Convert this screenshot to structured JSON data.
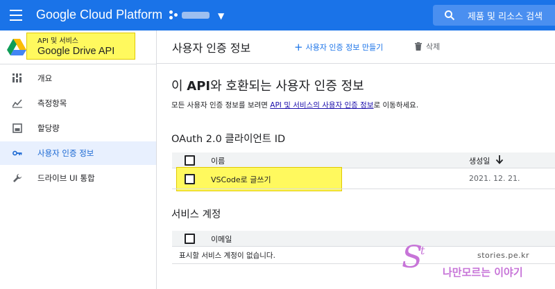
{
  "topbar": {
    "menu_icon": "hamburger-menu-icon",
    "brand": "Google Cloud Platform",
    "project_icon": "project-dots-icon",
    "project_name_redacted": true,
    "dropdown_icon": "caret-down-icon",
    "search_icon": "search-icon",
    "search_placeholder": "제품 및 리소스 검색",
    "bar_color": "#1a73e8"
  },
  "sidebar": {
    "api_kicker": "API 및 서비스",
    "api_name": "Google Drive API",
    "api_logo": "google-drive-logo",
    "items": [
      {
        "label": "개요",
        "icon": "dashboard-icon",
        "active": false
      },
      {
        "label": "측정항목",
        "icon": "metrics-icon",
        "active": false
      },
      {
        "label": "할당량",
        "icon": "quota-icon",
        "active": false
      },
      {
        "label": "사용자 인증 정보",
        "icon": "key-icon",
        "active": true
      },
      {
        "label": "드라이브 UI 통합",
        "icon": "wrench-icon",
        "active": false
      }
    ]
  },
  "header": {
    "title": "사용자 인증 정보",
    "create_label": "사용자 인증 정보 만들기",
    "create_icon": "plus-icon",
    "delete_label": "삭제",
    "delete_icon": "trash-icon"
  },
  "content": {
    "heading_pre": "이 ",
    "heading_bold": "API",
    "heading_post": "와 호환되는 사용자 인증 정보",
    "desc_pre": "모든 사용자 인증 정보를 보려면 ",
    "desc_link": "API 및 서비스의 사용자 인증 정보",
    "desc_post": "로 이동하세요."
  },
  "oauth": {
    "title": "OAuth 2.0 클라이언트 ID",
    "col_name": "이름",
    "col_date": "생성일",
    "sort_icon": "arrow-down-icon",
    "rows": [
      {
        "name": "VSCode로 글쓰기",
        "date": "2021. 12. 21."
      }
    ]
  },
  "service": {
    "title": "서비스 계정",
    "col_email": "이메일",
    "empty_text": "표시할 서비스 계정이 없습니다."
  },
  "watermark": {
    "glyph": "S",
    "glyph_sup": "t",
    "url": "stories.pe.kr",
    "text": "나만모르는 이야기"
  },
  "colors": {
    "highlight": "#fff95e",
    "accent": "#1a73e8",
    "active_bg": "#e8f0fe",
    "watermark": "#c774d8"
  }
}
